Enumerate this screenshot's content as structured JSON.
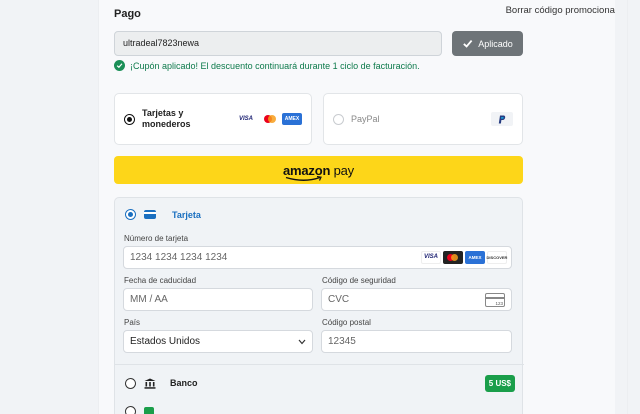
{
  "payment": {
    "title": "Pago",
    "remove_promo_label": "Borrar código promocional",
    "promo_code_value": "ultradeal7823newa",
    "apply_button_label": "Aplicado",
    "success_message": "¡Cupón aplicado! El descuento continuará durante 1 ciclo de facturación."
  },
  "methods": {
    "cards_label": "Tarjetas y monederos",
    "cards_logos": [
      "VISA",
      "mastercard",
      "AMEX"
    ],
    "paypal_label": "PayPal",
    "amazon_pay_label_a": "amazon",
    "amazon_pay_label_b": "pay"
  },
  "card_form": {
    "header_label": "Tarjeta",
    "card_number_label": "Número de tarjeta",
    "card_number_placeholder": "1234 1234 1234 1234",
    "brand_logos": [
      "VISA",
      "mastercard",
      "AMEX",
      "DISCOVER"
    ],
    "expiry_label": "Fecha de caducidad",
    "expiry_placeholder": "MM / AA",
    "cvc_label": "Código de seguridad",
    "cvc_placeholder": "CVC",
    "cvc_hint": "123",
    "country_label": "País",
    "country_value": "Estados Unidos",
    "postal_label": "Código postal",
    "postal_placeholder": "12345"
  },
  "bank": {
    "label": "Banco",
    "badge": "5 US$"
  },
  "colors": {
    "accent": "#1a6fc0",
    "success": "#0d7a4b",
    "amazon": "#fdd619",
    "badge": "#1a9e4a"
  },
  "icons": [
    "check-icon",
    "success-check-icon",
    "card-icon",
    "paypal-icon",
    "bank-icon",
    "chevron-down-icon",
    "cvc-card-icon"
  ]
}
